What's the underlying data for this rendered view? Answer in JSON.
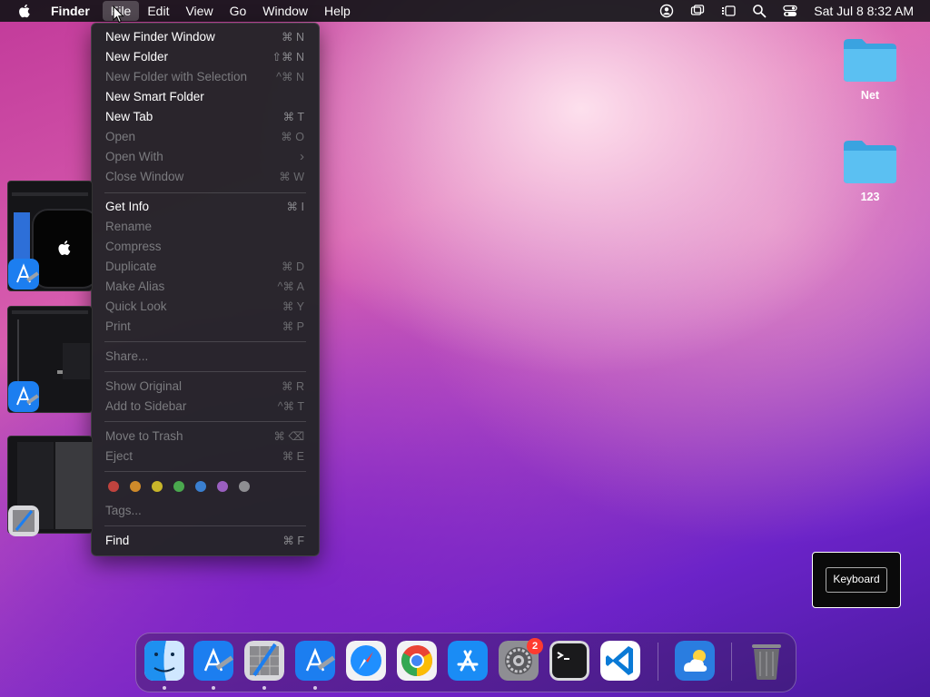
{
  "menubar": {
    "app_name": "Finder",
    "items": [
      "File",
      "Edit",
      "View",
      "Go",
      "Window",
      "Help"
    ],
    "active_item": "File",
    "clock": "Sat Jul 8  8:32 AM",
    "status_icons": [
      "user-icon",
      "screen-mirror-icon",
      "stage-manager-icon",
      "spotlight-icon",
      "control-center-icon"
    ]
  },
  "file_menu": {
    "items": [
      {
        "label": "New Finder Window",
        "shortcut": "⌘ N",
        "enabled": true
      },
      {
        "label": "New Folder",
        "shortcut": "⇧⌘ N",
        "enabled": true
      },
      {
        "label": "New Folder with Selection",
        "shortcut": "^⌘ N",
        "enabled": false
      },
      {
        "label": "New Smart Folder",
        "shortcut": "",
        "enabled": true
      },
      {
        "label": "New Tab",
        "shortcut": "⌘ T",
        "enabled": true
      },
      {
        "label": "Open",
        "shortcut": "⌘ O",
        "enabled": false
      },
      {
        "label": "Open With",
        "shortcut": "›",
        "enabled": false
      },
      {
        "label": "Close Window",
        "shortcut": "⌘ W",
        "enabled": false
      },
      {
        "label": "Get Info",
        "shortcut": "⌘ I",
        "enabled": true
      },
      {
        "label": "Rename",
        "shortcut": "",
        "enabled": false
      },
      {
        "label": "Compress",
        "shortcut": "",
        "enabled": false
      },
      {
        "label": "Duplicate",
        "shortcut": "⌘ D",
        "enabled": false
      },
      {
        "label": "Make Alias",
        "shortcut": "^⌘ A",
        "enabled": false
      },
      {
        "label": "Quick Look",
        "shortcut": "⌘ Y",
        "enabled": false
      },
      {
        "label": "Print",
        "shortcut": "⌘ P",
        "enabled": false
      },
      {
        "label": "Share...",
        "shortcut": "",
        "enabled": false
      },
      {
        "label": "Show Original",
        "shortcut": "⌘ R",
        "enabled": false
      },
      {
        "label": "Add to Sidebar",
        "shortcut": "^⌘ T",
        "enabled": false
      },
      {
        "label": "Move to Trash",
        "shortcut": "⌘ ⌫",
        "enabled": false
      },
      {
        "label": "Eject",
        "shortcut": "⌘ E",
        "enabled": false
      },
      {
        "label": "Tags...",
        "shortcut": "",
        "enabled": false
      },
      {
        "label": "Find",
        "shortcut": "⌘ F",
        "enabled": true
      }
    ],
    "tag_colors": [
      "#c0433e",
      "#cf8a2a",
      "#c8b52a",
      "#4aa84e",
      "#3a7fd0",
      "#9a5fc0",
      "#8e8e92"
    ]
  },
  "desktop_icons": [
    {
      "label": "Net"
    },
    {
      "label": "123"
    }
  ],
  "keyboard_indicator": {
    "label": "Keyboard"
  },
  "dock": {
    "apps": [
      "Finder",
      "Xcode",
      "Instruments",
      "Xcode",
      "Safari",
      "Google Chrome",
      "App Store",
      "System Settings",
      "Terminal",
      "Visual Studio Code",
      "Weather",
      "Trash"
    ],
    "system_settings_badge": "2"
  }
}
